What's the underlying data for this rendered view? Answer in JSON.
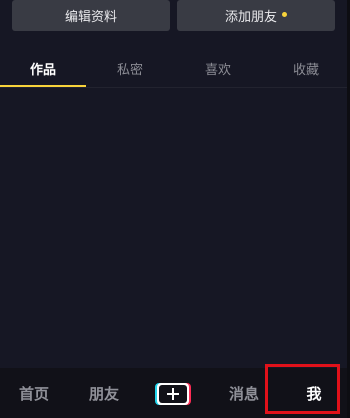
{
  "actions": {
    "edit_profile_label": "编辑资料",
    "add_friend_label": "添加朋友"
  },
  "tabs": [
    {
      "label": "作品",
      "active": true
    },
    {
      "label": "私密",
      "active": false
    },
    {
      "label": "喜欢",
      "active": false
    },
    {
      "label": "收藏",
      "active": false
    }
  ],
  "bottom_nav": {
    "home": "首页",
    "friends": "朋友",
    "create": "+",
    "messages": "消息",
    "me": "我"
  },
  "colors": {
    "background": "#161724",
    "accent": "#f8d33b",
    "highlight_box": "#e0111a"
  }
}
